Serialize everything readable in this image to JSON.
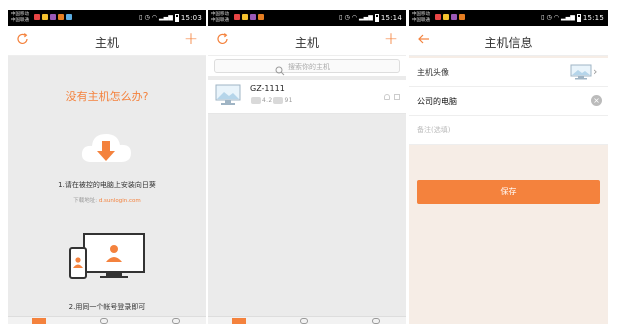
{
  "colors": {
    "accent": "#f4823d",
    "statusbar": "#000000",
    "page_bg": "#ebebeb",
    "info_bg": "#f6ede6"
  },
  "screens": [
    {
      "status": {
        "carrier1": "中国移动",
        "carrier2": "中国联通",
        "time": "15:03"
      },
      "topbar": {
        "title": "主机",
        "left_icon": "refresh-icon",
        "right_icon": "plus-icon"
      },
      "empty": {
        "question": "没有主机怎么办?",
        "step1": "1.请在被控的电脑上安装向日葵",
        "download_label": "下载地址:",
        "download_link": "d.sunlogin.com",
        "step2": "2.用同一个帐号登录即可"
      }
    },
    {
      "status": {
        "carrier1": "中国移动",
        "carrier2": "中国联通",
        "time": "15:14"
      },
      "topbar": {
        "title": "主机",
        "left_icon": "refresh-icon",
        "right_icon": "plus-icon"
      },
      "search": {
        "placeholder": "搜索你的主机"
      },
      "hosts": [
        {
          "name": "GZ-1111",
          "ip_parts": [
            "4.2",
            "91"
          ]
        }
      ]
    },
    {
      "status": {
        "carrier1": "中国移动",
        "carrier2": "中国联通",
        "time": "15:15"
      },
      "topbar": {
        "title": "主机信息",
        "left_icon": "back-arrow-icon"
      },
      "form": {
        "avatar_label": "主机头像",
        "name_value": "公司的电脑",
        "note_placeholder": "备注(选填)",
        "save_label": "保存"
      }
    }
  ]
}
